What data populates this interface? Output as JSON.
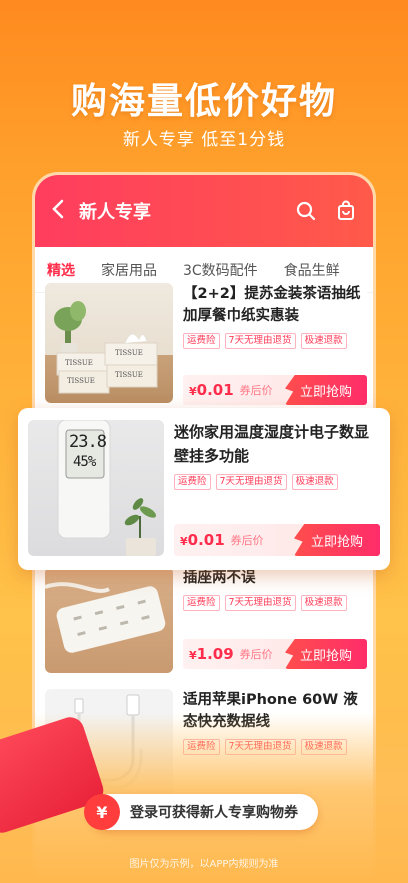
{
  "hero": {
    "title": "购海量低价好物",
    "subtitle": "新人专享 低至1分钱"
  },
  "header": {
    "title": "新人专享",
    "icons": [
      "back-icon",
      "search-icon",
      "bag-icon"
    ]
  },
  "tabs": [
    {
      "label": "精选",
      "active": true
    },
    {
      "label": "家居用品",
      "active": false
    },
    {
      "label": "3C数码配件",
      "active": false
    },
    {
      "label": "食品生鲜",
      "active": false
    }
  ],
  "tags": [
    "运费险",
    "7天无理由退货",
    "极速退款"
  ],
  "buy_label": "立即抢购",
  "after_label": "券后价",
  "currency": "¥",
  "products": [
    {
      "title": "【2+2】提苏金装茶语抽纸加厚餐巾纸实惠装",
      "price": "0.01",
      "image_text": [
        "TISSUE",
        "TISSUE",
        "TISSUE",
        "TISSUE"
      ]
    },
    {
      "title": "迷你家用温度湿度计电子数显壁挂多功能",
      "price": "0.01",
      "display_temp": "23.8",
      "display_hum": "45%"
    },
    {
      "title": "插座两不误",
      "price": "1.09"
    },
    {
      "title": "适用苹果iPhone 60W 液态快充数据线",
      "price": ""
    }
  ],
  "coupon": {
    "icon_text": "¥",
    "text": "登录可获得新人专享购物券"
  },
  "disclaimer": "图片仅为示例，以APP内规则为准",
  "colors": {
    "accent": "#ff2d4b",
    "header_gradient": [
      "#ff3d5e",
      "#ff5a4a"
    ],
    "background": "#ffb23a"
  }
}
